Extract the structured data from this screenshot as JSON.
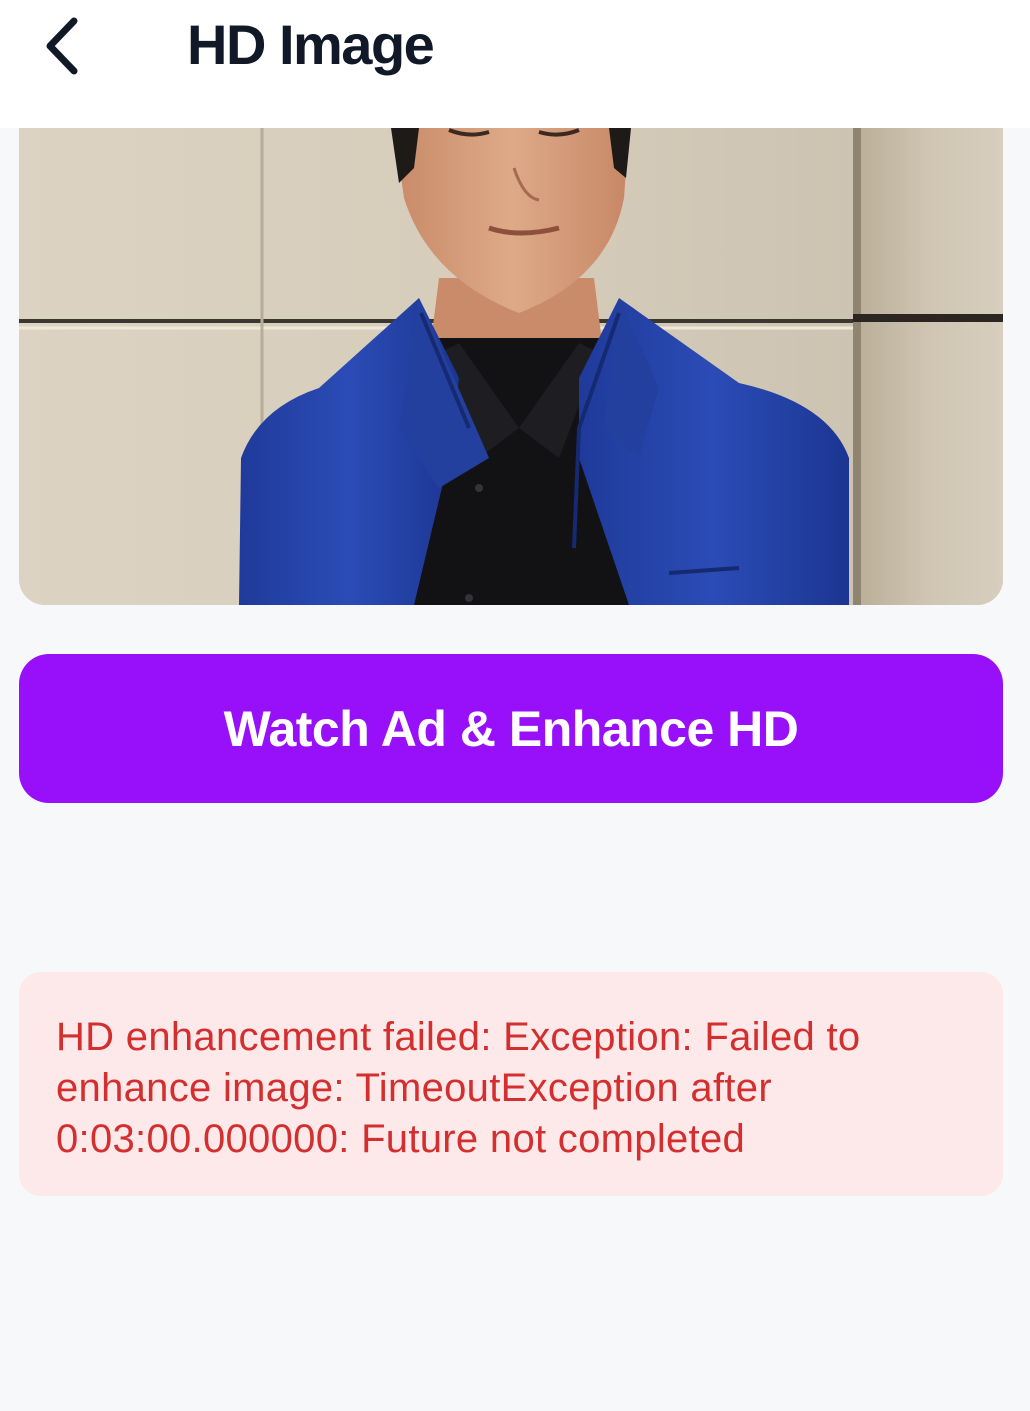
{
  "header": {
    "title": "HD Image",
    "back_icon": "chevron-left-icon"
  },
  "preview": {
    "description": "photo"
  },
  "actions": {
    "enhance_label": "Watch Ad & Enhance HD"
  },
  "error": {
    "message": "HD enhancement failed: Exception: Failed to enhance image: TimeoutException after 0:03:00.000000: Future not completed"
  },
  "colors": {
    "accent": "#9810fa",
    "error_text": "#d32f2f",
    "error_bg": "#fde8ea",
    "title_text": "#111827",
    "page_bg": "#f7f8fa"
  }
}
